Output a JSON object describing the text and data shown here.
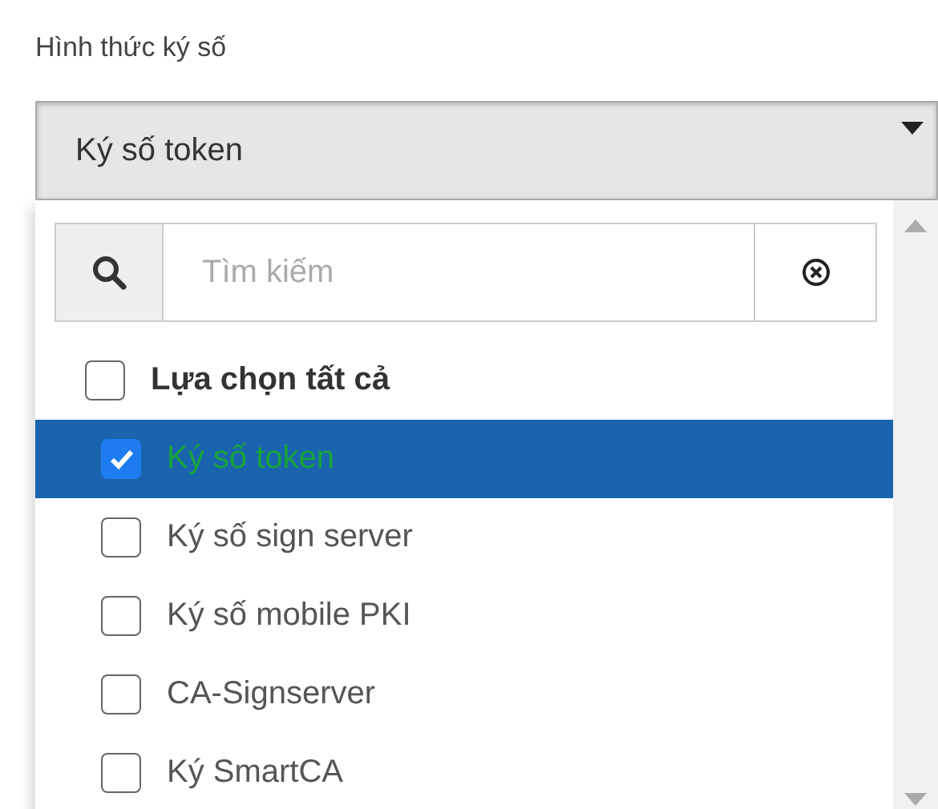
{
  "label": "Hình thức ký số",
  "select": {
    "value": "Ký số token",
    "expanded": true
  },
  "search": {
    "placeholder": "Tìm kiếm"
  },
  "select_all": {
    "label": "Lựa chọn tất cả",
    "checked": false
  },
  "options": [
    {
      "label": "Ký số token",
      "checked": true,
      "selected": true
    },
    {
      "label": "Ký số sign server",
      "checked": false,
      "selected": false
    },
    {
      "label": "Ký số mobile PKI",
      "checked": false,
      "selected": false
    },
    {
      "label": "CA-Signserver",
      "checked": false,
      "selected": false
    },
    {
      "label": "Ký SmartCA",
      "checked": false,
      "selected": false
    }
  ]
}
